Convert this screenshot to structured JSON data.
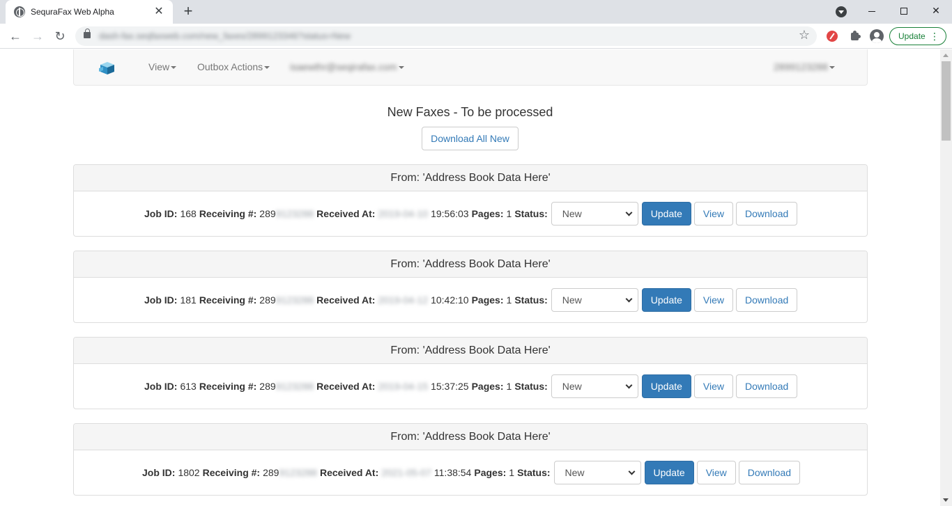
{
  "browser": {
    "tab_title": "SequraFax Web Alpha",
    "url": "dash-fax.seqfaxweb.com/new_faxes/2899123346?status=New",
    "update_label": "Update"
  },
  "navbar": {
    "menu_view": "View",
    "menu_outbox": "Outbox Actions",
    "user_email": "isaewthr@seqirafax.com",
    "account_number": "2899123288"
  },
  "page": {
    "heading": "New Faxes - To be processed",
    "download_all_label": "Download All New"
  },
  "labels": {
    "job_id": "Job ID:",
    "receiving": "Receiving #:",
    "received_at": "Received At:",
    "pages": "Pages:",
    "status": "Status:",
    "update": "Update",
    "view": "View",
    "download": "Download"
  },
  "faxes": [
    {
      "from": "From: 'Address Book Data Here'",
      "job_id": "168",
      "receiving_prefix": "289",
      "receiving_hidden": "9123288",
      "received_date_hidden": "2019-04-10",
      "received_time": "19:56:03",
      "pages": "1",
      "status": "New"
    },
    {
      "from": "From: 'Address Book Data Here'",
      "job_id": "181",
      "receiving_prefix": "289",
      "receiving_hidden": "9123288",
      "received_date_hidden": "2019-04-12",
      "received_time": "10:42:10",
      "pages": "1",
      "status": "New"
    },
    {
      "from": "From: 'Address Book Data Here'",
      "job_id": "613",
      "receiving_prefix": "289",
      "receiving_hidden": "9123288",
      "received_date_hidden": "2019-04-15",
      "received_time": "15:37:25",
      "pages": "1",
      "status": "New"
    },
    {
      "from": "From: 'Address Book Data Here'",
      "job_id": "1802",
      "receiving_prefix": "289",
      "receiving_hidden": "9123288",
      "received_date_hidden": "2021-05-07",
      "received_time": "11:38:54",
      "pages": "1",
      "status": "New"
    }
  ]
}
